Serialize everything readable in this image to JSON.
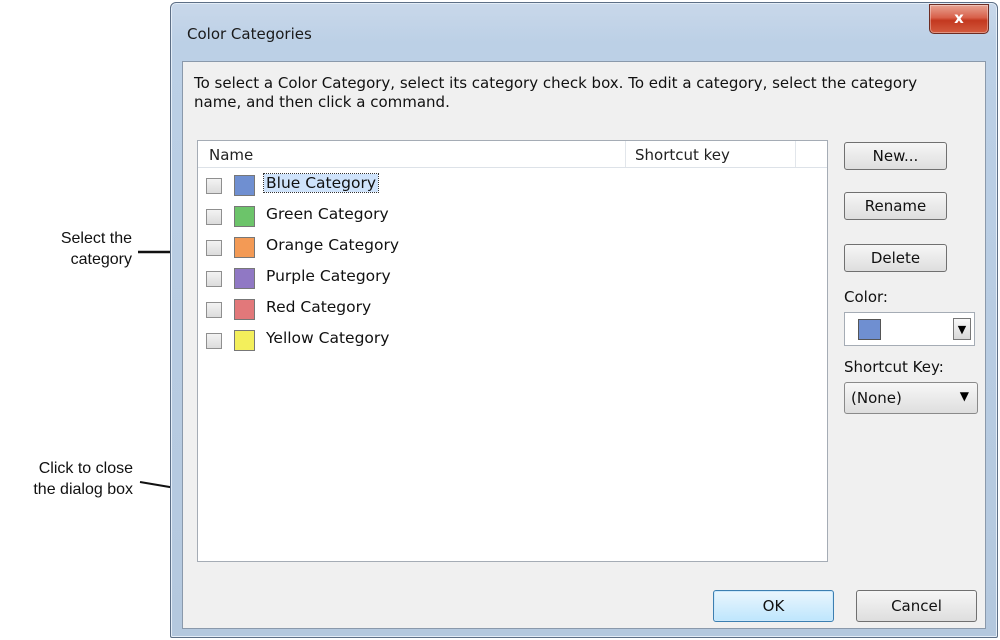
{
  "callouts": {
    "select_line1": "Select the",
    "select_line2": "category",
    "close_line1": "Click to close",
    "close_line2": "the dialog box"
  },
  "dialog": {
    "title": "Color Categories",
    "close_glyph": "x",
    "instruction": "To select a Color Category, select its category check box.  To edit a category, select the category name, and then click a command.",
    "columns": {
      "name": "Name",
      "shortcut": "Shortcut key"
    },
    "categories": [
      {
        "label": "Blue Category",
        "color": "#6f8fd1",
        "checked": false,
        "focused": true
      },
      {
        "label": "Green Category",
        "color": "#6cc46a",
        "checked": false,
        "focused": false
      },
      {
        "label": "Orange Category",
        "color": "#f39a55",
        "checked": false,
        "focused": false
      },
      {
        "label": "Purple Category",
        "color": "#9078c4",
        "checked": false,
        "focused": false
      },
      {
        "label": "Red Category",
        "color": "#e2787a",
        "checked": false,
        "focused": false
      },
      {
        "label": "Yellow Category",
        "color": "#f3ef5b",
        "checked": false,
        "focused": false
      }
    ],
    "buttons": {
      "new": "New...",
      "rename": "Rename",
      "delete": "Delete",
      "ok": "OK",
      "cancel": "Cancel"
    },
    "color_label": "Color:",
    "selected_color": "#6f8fd1",
    "shortcut_label": "Shortcut Key:",
    "shortcut_value": "(None)"
  }
}
